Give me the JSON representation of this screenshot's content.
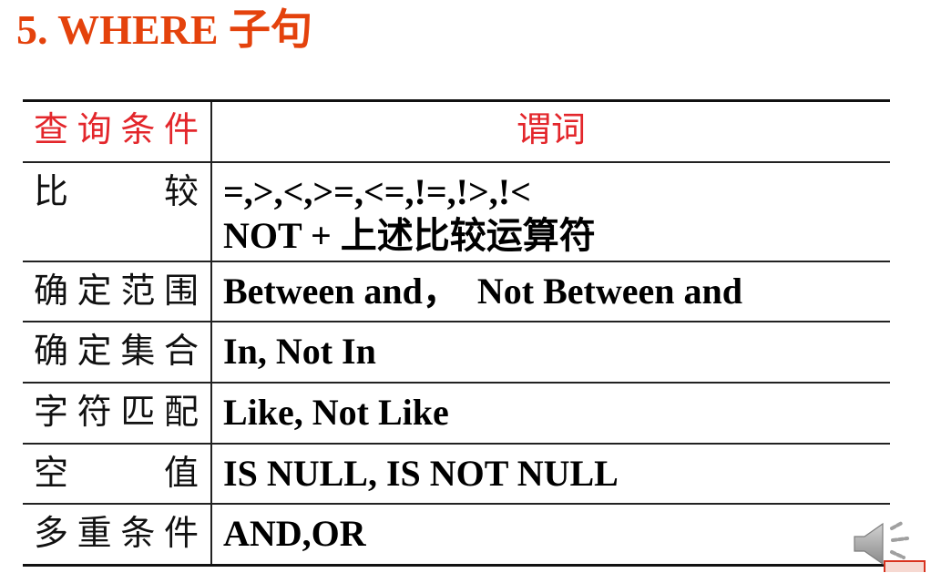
{
  "slide": {
    "title": "5. WHERE 子句",
    "title_color": "#e4420c"
  },
  "table": {
    "header_color": "#e3262b",
    "header": {
      "condition": "查询条件",
      "predicate": "谓词"
    },
    "rows": [
      {
        "condition": "比较",
        "predicate_lines": [
          "=,>,<,>=,<=,!=,!>,!<",
          "NOT + 上述比较运算符"
        ]
      },
      {
        "condition": "确定范围",
        "predicate_lines": [
          "Between and，  Not Between and"
        ]
      },
      {
        "condition": "确定集合",
        "predicate_lines": [
          "In, Not In"
        ]
      },
      {
        "condition": "字符匹配",
        "predicate_lines": [
          "Like, Not Like"
        ]
      },
      {
        "condition": "空值",
        "predicate_lines": [
          "IS NULL, IS NOT NULL"
        ]
      },
      {
        "condition": "多重条件",
        "predicate_lines": [
          "AND,OR"
        ]
      }
    ]
  },
  "icons": {
    "audio": "speaker-icon"
  },
  "colors": {
    "text": "#000000",
    "rule": "#111111",
    "speaker": "#9a9a9a",
    "corner_marker": "#d8331f"
  }
}
